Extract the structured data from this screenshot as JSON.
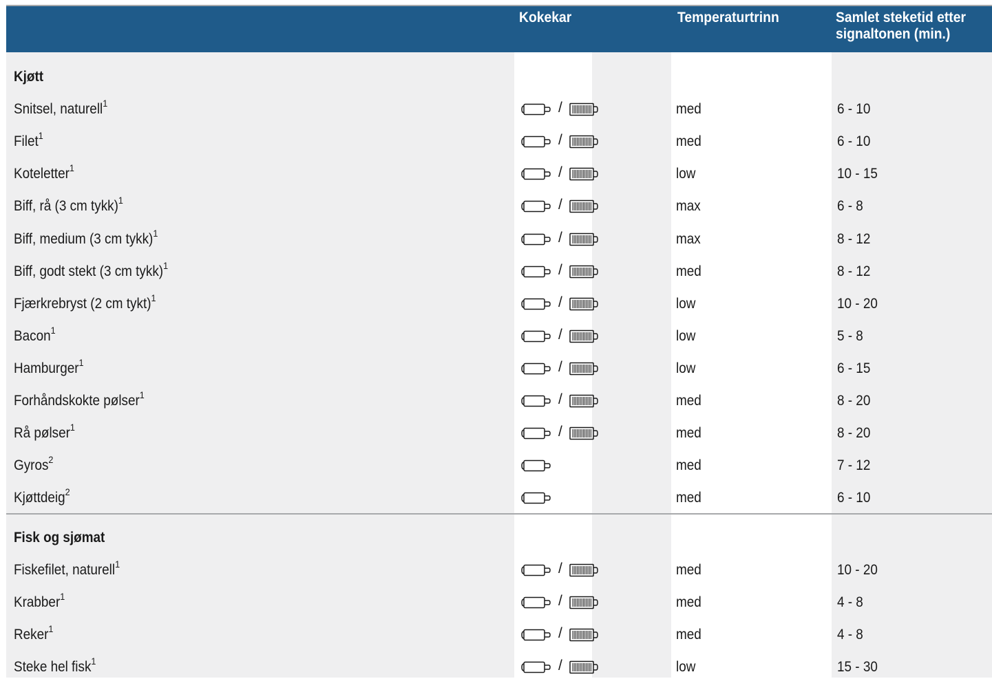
{
  "header": {
    "col_cookware": "Kokekar",
    "col_temp": "Temperaturtrinn",
    "col_time_line1": "Samlet steketid etter",
    "col_time_line2": "signaltonen (min.)"
  },
  "sections": [
    {
      "title": "Kjøtt",
      "rows": [
        {
          "food": "Snitsel, naturell",
          "note": "1",
          "cookware": "pan-or-grill",
          "temp": "med",
          "time": "6 - 10"
        },
        {
          "food": "Filet",
          "note": "1",
          "cookware": "pan-or-grill",
          "temp": "med",
          "time": "6 - 10"
        },
        {
          "food": "Koteletter",
          "note": "1",
          "cookware": "pan-or-grill",
          "temp": "low",
          "time": "10 - 15"
        },
        {
          "food": "Biff, rå (3 cm tykk)",
          "note": "1",
          "cookware": "pan-or-grill",
          "temp": "max",
          "time": "6 - 8"
        },
        {
          "food": "Biff, medium (3 cm tykk)",
          "note": "1",
          "cookware": "pan-or-grill",
          "temp": "max",
          "time": "8 - 12"
        },
        {
          "food": "Biff, godt stekt (3 cm tykk)",
          "note": "1",
          "cookware": "pan-or-grill",
          "temp": "med",
          "time": "8 - 12"
        },
        {
          "food": "Fjærkrebryst (2 cm tykt)",
          "note": "1",
          "cookware": "pan-or-grill",
          "temp": "low",
          "time": "10 - 20"
        },
        {
          "food": "Bacon",
          "note": "1",
          "cookware": "pan-or-grill",
          "temp": "low",
          "time": "5 - 8"
        },
        {
          "food": "Hamburger",
          "note": "1",
          "cookware": "pan-or-grill",
          "temp": "low",
          "time": "6 - 15"
        },
        {
          "food": "Forhåndskokte pølser",
          "note": "1",
          "cookware": "pan-or-grill",
          "temp": "med",
          "time": "8 - 20"
        },
        {
          "food": "Rå pølser",
          "note": "1",
          "cookware": "pan-or-grill",
          "temp": "med",
          "time": "8 - 20"
        },
        {
          "food": "Gyros",
          "note": "2",
          "cookware": "pan",
          "temp": "med",
          "time": "7 - 12"
        },
        {
          "food": "Kjøttdeig",
          "note": "2",
          "cookware": "pan",
          "temp": "med",
          "time": "6 - 10"
        }
      ]
    },
    {
      "title": "Fisk og sjømat",
      "rows": [
        {
          "food": "Fiskefilet, naturell",
          "note": "1",
          "cookware": "pan-or-grill",
          "temp": "med",
          "time": "10 - 20"
        },
        {
          "food": "Krabber",
          "note": "1",
          "cookware": "pan-or-grill",
          "temp": "med",
          "time": "4 - 8"
        },
        {
          "food": "Reker",
          "note": "1",
          "cookware": "pan-or-grill",
          "temp": "med",
          "time": "4 - 8"
        },
        {
          "food": "Steke hel fisk",
          "note": "1",
          "cookware": "pan-or-grill",
          "temp": "low",
          "time": "15 - 30"
        }
      ]
    }
  ],
  "cookware_separator": "/",
  "colors": {
    "header_bg": "#1f5b8a",
    "stripe_bg": "#efeff0",
    "rule": "#a7a9ab"
  }
}
